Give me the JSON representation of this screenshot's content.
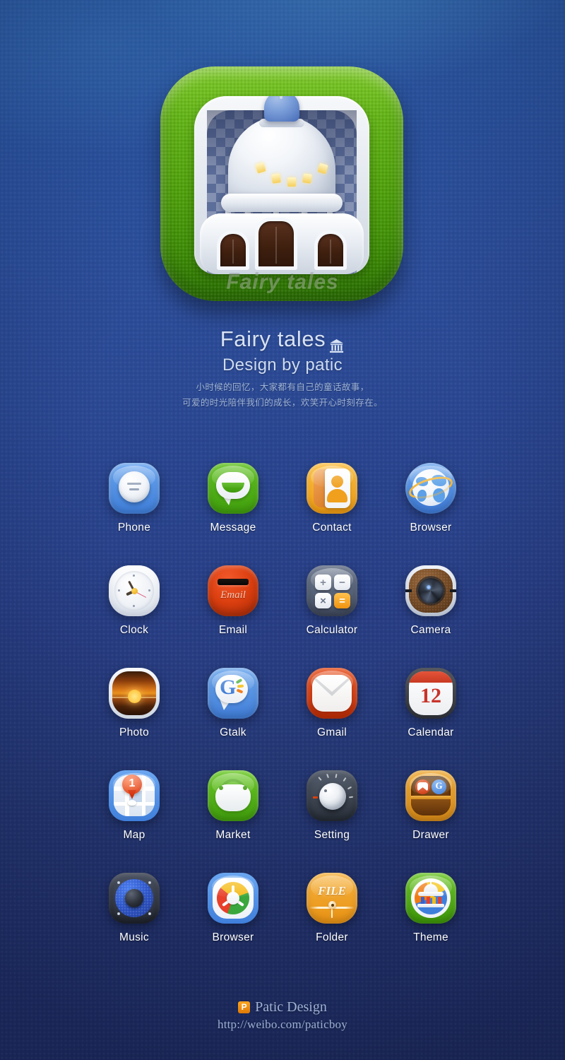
{
  "hero": {
    "wordmark": "Fairy tales",
    "icon_name": "fairy-tales-palace-icon",
    "flag_color": "#f07b12",
    "tile_color": "#4fa00c"
  },
  "titles": {
    "app_title": "Fairy tales",
    "subtitle": "Design by patic",
    "description_line_1": "小时候的回忆，大家都有自己的童话故事，",
    "description_line_2": "可爱的时光陪伴我们的成长，欢笑开心时刻存在。"
  },
  "calendar_day": "12",
  "map_badge": "1",
  "email_wordmark": "Email",
  "folder_wordmark": "FILE",
  "gtalk_letter": "G",
  "calculator_keys": [
    "+",
    "−",
    "×",
    "="
  ],
  "grid": {
    "rows": 5,
    "columns": 4,
    "items": [
      {
        "label": "Phone",
        "icon": "phone-icon",
        "color": "#4f8ce2"
      },
      {
        "label": "Message",
        "icon": "message-icon",
        "color": "#4faa11"
      },
      {
        "label": "Contact",
        "icon": "contact-icon",
        "color": "#f2a820"
      },
      {
        "label": "Browser",
        "icon": "globe-icon",
        "color": "#4c87de"
      },
      {
        "label": "Clock",
        "icon": "clock-icon",
        "color": "#eef1f6"
      },
      {
        "label": "Email",
        "icon": "mailbox-icon",
        "color": "#d8400f"
      },
      {
        "label": "Calculator",
        "icon": "calculator-icon",
        "color": "#5a6679"
      },
      {
        "label": "Camera",
        "icon": "camera-icon",
        "color": "#7a4e27"
      },
      {
        "label": "Photo",
        "icon": "photo-icon",
        "color": "#d9781a"
      },
      {
        "label": "Gtalk",
        "icon": "gtalk-icon",
        "color": "#4d87de"
      },
      {
        "label": "Gmail",
        "icon": "gmail-icon",
        "color": "#d4380f"
      },
      {
        "label": "Calendar",
        "icon": "calendar-icon",
        "color": "#c83a22"
      },
      {
        "label": "Map",
        "icon": "map-pin-icon",
        "color": "#4f8ce2"
      },
      {
        "label": "Market",
        "icon": "shopping-bag-icon",
        "color": "#4faa11"
      },
      {
        "label": "Setting",
        "icon": "knob-icon",
        "color": "#3c434f"
      },
      {
        "label": "Drawer",
        "icon": "app-drawer-icon",
        "color": "#e49a22"
      },
      {
        "label": "Music",
        "icon": "speaker-icon",
        "color": "#2d55c8"
      },
      {
        "label": "Browser",
        "icon": "compass-icon",
        "color": "#4f8ce2"
      },
      {
        "label": "Folder",
        "icon": "folder-icon",
        "color": "#ef9f21"
      },
      {
        "label": "Theme",
        "icon": "theme-temple-icon",
        "color": "#4faa11"
      }
    ]
  },
  "footer": {
    "logo_letter": "P",
    "brand": "Patic Design",
    "url": "http://weibo.com/paticboy"
  }
}
